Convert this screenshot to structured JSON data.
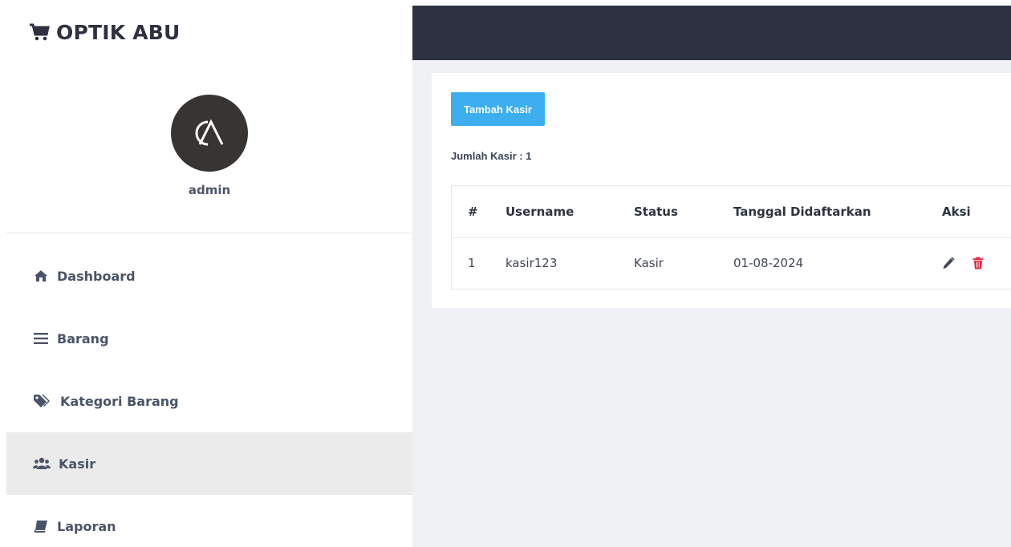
{
  "brand": {
    "name": "OPTIK ABU",
    "icon": "shopping-cart-icon"
  },
  "profile": {
    "name": "admin",
    "avatar_icon": "oa-logo"
  },
  "sidebar": {
    "items": [
      {
        "label": "Dashboard",
        "icon": "home-icon",
        "active": false
      },
      {
        "label": "Barang",
        "icon": "list-icon",
        "active": false
      },
      {
        "label": "Kategori Barang",
        "icon": "tags-icon",
        "active": false
      },
      {
        "label": "Kasir",
        "icon": "users-icon",
        "active": true
      },
      {
        "label": "Laporan",
        "icon": "book-icon",
        "active": false
      }
    ]
  },
  "main": {
    "add_button": "Tambah Kasir",
    "count_text": "Jumlah Kasir : 1",
    "table": {
      "headers": [
        "#",
        "Username",
        "Status",
        "Tanggal Didaftarkan",
        "Aksi"
      ],
      "rows": [
        {
          "no": "1",
          "username": "kasir123",
          "status": "Kasir",
          "date": "01-08-2024"
        }
      ]
    }
  },
  "colors": {
    "topbar": "#2e3141",
    "accent_button": "#3daef0",
    "delete_icon": "#e8273f",
    "active_nav": "#ebebeb"
  }
}
